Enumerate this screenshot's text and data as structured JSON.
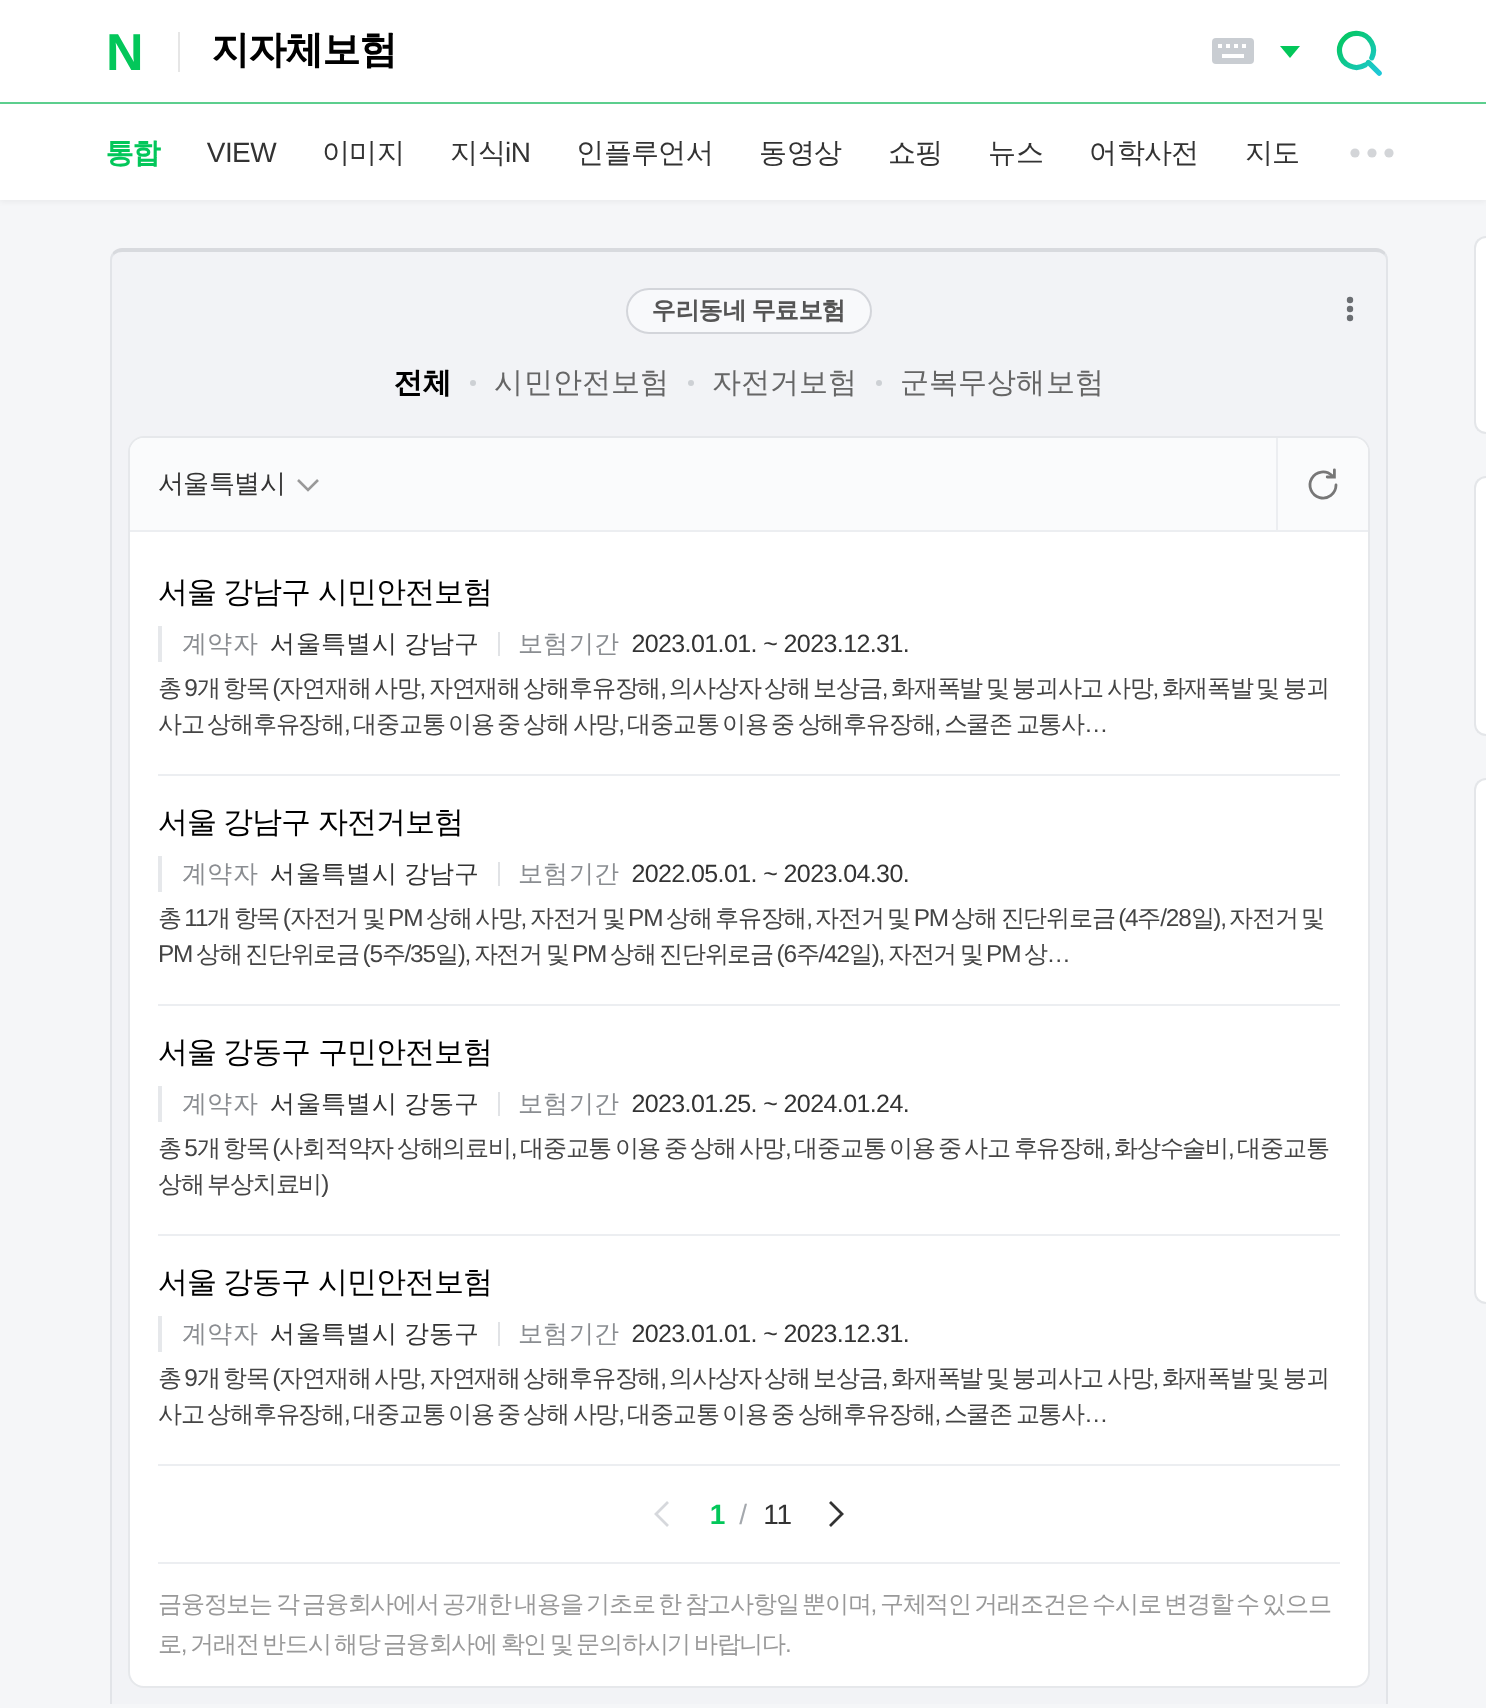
{
  "header": {
    "logo": "N",
    "search": {
      "value": "지자체보험"
    }
  },
  "nav_tabs": [
    {
      "label": "통합",
      "selected": true
    },
    {
      "label": "VIEW",
      "selected": false
    },
    {
      "label": "이미지",
      "selected": false
    },
    {
      "label": "지식iN",
      "selected": false
    },
    {
      "label": "인플루언서",
      "selected": false
    },
    {
      "label": "동영상",
      "selected": false
    },
    {
      "label": "쇼핑",
      "selected": false
    },
    {
      "label": "뉴스",
      "selected": false
    },
    {
      "label": "어학사전",
      "selected": false
    },
    {
      "label": "지도",
      "selected": false
    }
  ],
  "card": {
    "badge": "우리동네 무료보험",
    "filters": [
      {
        "label": "전체",
        "selected": true
      },
      {
        "label": "시민안전보험",
        "selected": false
      },
      {
        "label": "자전거보험",
        "selected": false
      },
      {
        "label": "군복무상해보험",
        "selected": false
      }
    ],
    "region": "서울특별시",
    "items": [
      {
        "title": "서울 강남구 시민안전보험",
        "contractor_label": "계약자",
        "contractor": "서울특별시 강남구",
        "period_label": "보험기간",
        "period": "2023.01.01. ~ 2023.12.31.",
        "description": "총 9개 항목 (자연재해 사망, 자연재해 상해후유장해, 의사상자 상해 보상금, 화재폭발 및 붕괴사고 사망, 화재폭발 및 붕괴사고 상해후유장해, 대중교통 이용 중 상해 사망, 대중교통 이용 중 상해후유장해, 스쿨존 교통사…"
      },
      {
        "title": "서울 강남구 자전거보험",
        "contractor_label": "계약자",
        "contractor": "서울특별시 강남구",
        "period_label": "보험기간",
        "period": "2022.05.01. ~ 2023.04.30.",
        "description": "총 11개 항목 (자전거 및 PM 상해 사망, 자전거 및 PM 상해 후유장해, 자전거 및 PM 상해 진단위로금 (4주/28일), 자전거 및 PM 상해 진단위로금 (5주/35일), 자전거 및 PM 상해 진단위로금 (6주/42일), 자전거 및 PM 상…"
      },
      {
        "title": "서울 강동구 구민안전보험",
        "contractor_label": "계약자",
        "contractor": "서울특별시 강동구",
        "period_label": "보험기간",
        "period": "2023.01.25. ~ 2024.01.24.",
        "description": "총 5개 항목 (사회적약자 상해의료비, 대중교통 이용 중 상해 사망, 대중교통 이용 중 사고 후유장해, 화상수술비, 대중교통상해 부상치료비)"
      },
      {
        "title": "서울 강동구 시민안전보험",
        "contractor_label": "계약자",
        "contractor": "서울특별시 강동구",
        "period_label": "보험기간",
        "period": "2023.01.01. ~ 2023.12.31.",
        "description": "총 9개 항목 (자연재해 사망, 자연재해 상해후유장해, 의사상자 상해 보상금, 화재폭발 및 붕괴사고 사망, 화재폭발 및 붕괴사고 상해후유장해, 대중교통 이용 중 상해 사망, 대중교통 이용 중 상해후유장해, 스쿨존 교통사…"
      }
    ],
    "pagination": {
      "prev_disabled": true,
      "current": "1",
      "separator": "/",
      "total": "11",
      "next_disabled": false
    },
    "disclaimer": "금융정보는 각 금융회사에서 공개한 내용을 기초로 한 참고사항일 뿐이며, 구체적인 거래조건은 수시로 변경할 수 있으므로, 거래전 반드시 해당 금융회사에 확인 및 문의하시기 바랍니다."
  }
}
